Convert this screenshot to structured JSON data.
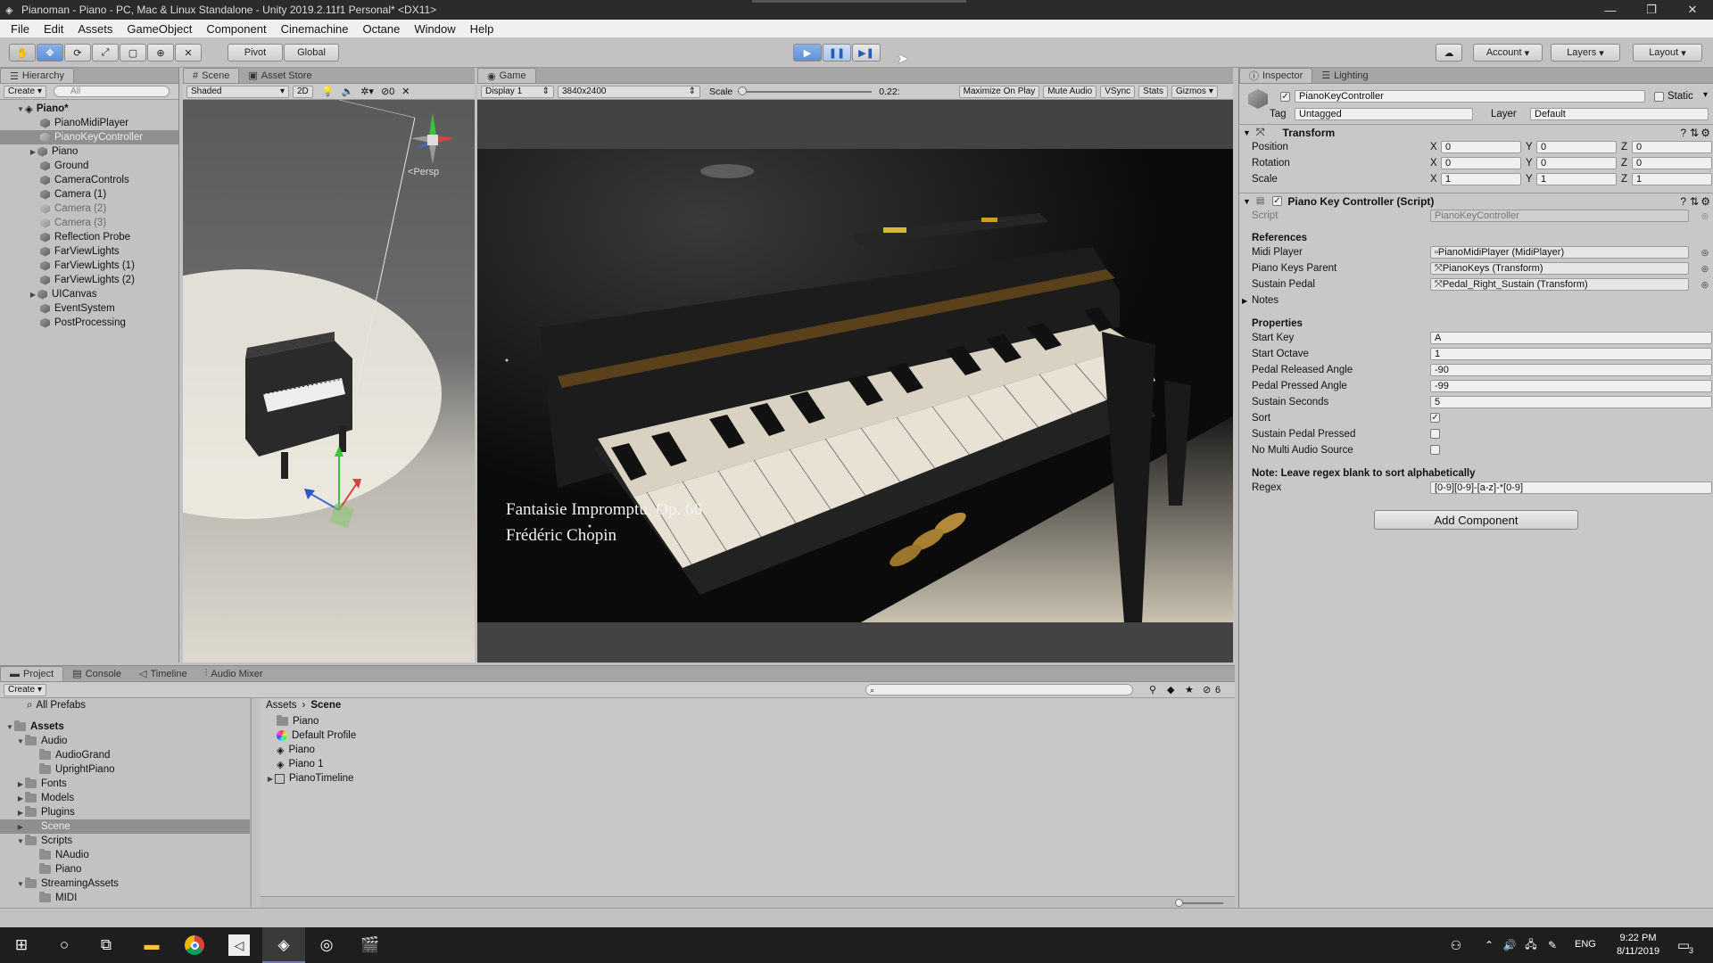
{
  "window": {
    "title": "Pianoman - Piano - PC, Mac & Linux Standalone - Unity 2019.2.11f1 Personal* <DX11>"
  },
  "menu": [
    "File",
    "Edit",
    "Assets",
    "GameObject",
    "Component",
    "Cinemachine",
    "Octane",
    "Window",
    "Help"
  ],
  "toolbar": {
    "pivot": "Pivot",
    "global": "Global",
    "account": "Account",
    "layers": "Layers",
    "layout": "Layout"
  },
  "hierarchy": {
    "tab": "Hierarchy",
    "create": "Create",
    "search_placeholder": "All",
    "root": "Piano*",
    "items": [
      "PianoMidiPlayer",
      "PianoKeyController",
      "Piano",
      "Ground",
      "CameraControls",
      "Camera (1)",
      "Camera (2)",
      "Camera (3)",
      "Reflection Probe",
      "FarViewLights",
      "FarViewLights (1)",
      "FarViewLights (2)",
      "UICanvas",
      "EventSystem",
      "PostProcessing"
    ]
  },
  "scene": {
    "tab": "Scene",
    "tab2": "Asset Store",
    "shading": "Shaded",
    "mode2d": "2D",
    "gizmo_count": "0",
    "persp": "Persp"
  },
  "game": {
    "tab": "Game",
    "display": "Display 1",
    "resolution": "3840x2400",
    "scale_label": "Scale",
    "scale_value": "0.22:",
    "maximize": "Maximize On Play",
    "mute": "Mute Audio",
    "vsync": "VSync",
    "stats": "Stats",
    "gizmos": "Gizmos",
    "caption_line1": "Fantaisie Impromptu, Op. 66",
    "caption_line2": "Frédéric Chopin"
  },
  "inspector": {
    "tab": "Inspector",
    "tab2": "Lighting",
    "object_name": "PianoKeyController",
    "static": "Static",
    "tag_label": "Tag",
    "tag_value": "Untagged",
    "layer_label": "Layer",
    "layer_value": "Default",
    "transform": {
      "title": "Transform",
      "position": "Position",
      "rotation": "Rotation",
      "scale": "Scale",
      "pos": [
        "0",
        "0",
        "0"
      ],
      "rot": [
        "0",
        "0",
        "0"
      ],
      "scl": [
        "1",
        "1",
        "1"
      ]
    },
    "script": {
      "title": "Piano Key Controller (Script)",
      "script_label": "Script",
      "script_value": "PianoKeyController",
      "references": "References",
      "midi_label": "Midi Player",
      "midi_value": "PianoMidiPlayer (MidiPlayer)",
      "keys_label": "Piano Keys Parent",
      "keys_value": "PianoKeys (Transform)",
      "pedal_label": "Sustain Pedal",
      "pedal_value": "Pedal_Right_Sustain (Transform)",
      "notes": "Notes",
      "properties": "Properties",
      "start_key_label": "Start Key",
      "start_key": "A",
      "start_octave_label": "Start Octave",
      "start_octave": "1",
      "released_label": "Pedal Released Angle",
      "released": "-90",
      "pressed_label": "Pedal Pressed Angle",
      "pressed": "-99",
      "sustain_label": "Sustain Seconds",
      "sustain": "5",
      "sort_label": "Sort",
      "sustain_pressed_label": "Sustain Pedal Pressed",
      "multi_label": "No Multi Audio Source",
      "note": "Note: Leave regex blank to sort alphabetically",
      "regex_label": "Regex",
      "regex": "[0-9][0-9]-[a-z]-*[0-9]"
    },
    "add_component": "Add Component"
  },
  "project": {
    "tabs": [
      "Project",
      "Console",
      "Timeline",
      "Audio Mixer"
    ],
    "create": "Create",
    "all_prefabs": "All Prefabs",
    "tree": [
      "Assets",
      "Audio",
      "AudioGrand",
      "UprightPiano",
      "Fonts",
      "Models",
      "Plugins",
      "Scene",
      "Scripts",
      "NAudio",
      "Piano",
      "StreamingAssets",
      "MIDI"
    ],
    "breadcrumb": [
      "Assets",
      "Scene"
    ],
    "files": [
      "Piano",
      "Default Profile",
      "Piano",
      "Piano 1",
      "PianoTimeline"
    ],
    "hidden_count": "6"
  },
  "taskbar": {
    "time": "9:22 PM",
    "date": "8/11/2019",
    "lang": "ENG",
    "notif": "3"
  }
}
